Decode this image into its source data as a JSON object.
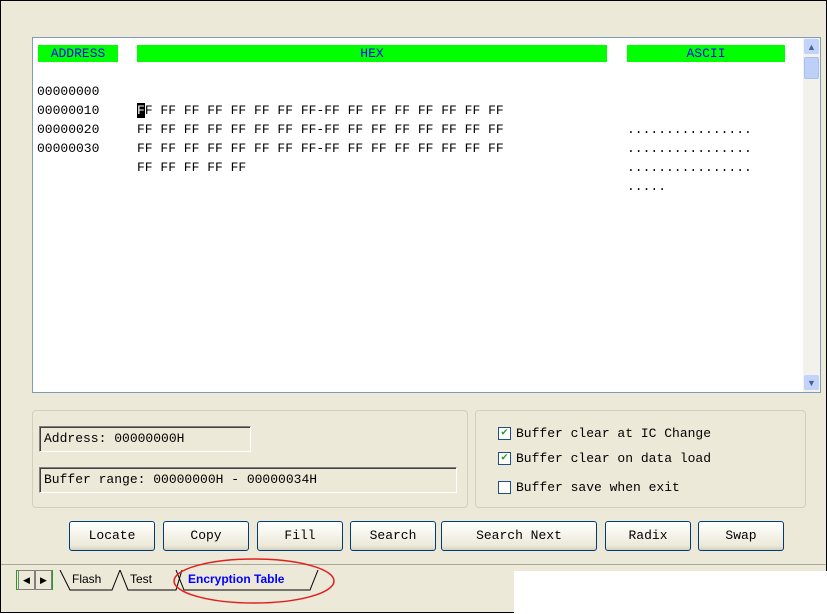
{
  "hex_view": {
    "headers": {
      "address": "ADDRESS",
      "hex": "HEX",
      "ascii": "ASCII"
    },
    "rows": [
      {
        "address": "00000000",
        "hex_cursor": "F",
        "hex": "F FF FF FF FF FF FF FF-FF FF FF FF FF FF FF FF",
        "ascii": "................"
      },
      {
        "address": "00000010",
        "hex": "FF FF FF FF FF FF FF FF-FF FF FF FF FF FF FF FF",
        "ascii": "................"
      },
      {
        "address": "00000020",
        "hex": "FF FF FF FF FF FF FF FF-FF FF FF FF FF FF FF FF",
        "ascii": "................"
      },
      {
        "address": "00000030",
        "hex": "FF FF FF FF FF",
        "ascii": "....."
      }
    ]
  },
  "info": {
    "address": "Address: 00000000H",
    "buffer_range": "Buffer range: 00000000H - 00000034H"
  },
  "options": [
    {
      "label": "Buffer clear at IC Change",
      "checked": true
    },
    {
      "label": "Buffer clear on data load",
      "checked": true
    },
    {
      "label": "Buffer save when exit",
      "checked": false
    }
  ],
  "buttons": [
    "Locate",
    "Copy",
    "Fill",
    "Search",
    "Search Next",
    "Radix",
    "Swap"
  ],
  "tabs": [
    "Flash",
    "Test",
    "Encryption Table"
  ],
  "colors": {
    "header_bg": "#00ff00",
    "header_text": "#0000ff",
    "active_tab_text": "#0000ff",
    "annotation_ellipse": "#e02020"
  }
}
